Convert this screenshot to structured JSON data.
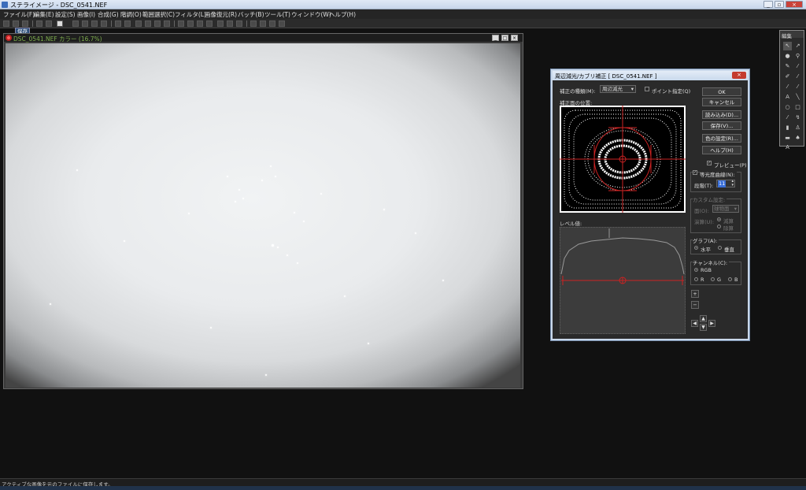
{
  "window": {
    "title": "ステライメージ - DSC_0541.NEF",
    "buttons": {
      "minimize": "_",
      "maximize": "▫",
      "close": "×"
    }
  },
  "menu": [
    "ファイル(F)",
    "編集(E)",
    "設定(S)",
    "画像(I)",
    "合成(G)",
    "階調(O)",
    "範囲選択(C)",
    "フィルタ(L)",
    "画像復元(R)",
    "バッチ(B)",
    "ツール(T)",
    "ウィンドウ(W)",
    "ヘルプ(H)"
  ],
  "toolbar": {
    "tooltip": "保存"
  },
  "image_window": {
    "title": "DSC_0541.NEF カラー (16.7%)",
    "buttons": {
      "minimize": "_",
      "maximize": "□",
      "close": "×"
    }
  },
  "dialog": {
    "title": "周辺減光/カブリ補正 [ DSC_0541.NEF ]",
    "close": "×",
    "correction_type_label": "補正の種類(M):",
    "correction_type_value": "周辺減光",
    "point_checkbox": "ポイント指定(Q)",
    "surface_label": "補正面の位置:",
    "level_label": "レベル値:",
    "buttons": [
      "OK",
      "キャンセル",
      "読み込み(D)...",
      "保存(V)...",
      "色の設定(R)...",
      "ヘルプ(H)"
    ],
    "preview_label": "プレビュー(P)",
    "contour_label": "等光度曲線(N):",
    "steps_label": "段階(T):",
    "steps_value": "11",
    "custom_group": {
      "title": "カスタム設定:",
      "object_label": "面(O):",
      "object_value": "球物面",
      "operation_label": "演算(U):",
      "radio_a": "減算",
      "radio_b": "除算"
    },
    "graph_group": {
      "title": "グラフ(A):",
      "horizontal": "水平",
      "vertical": "垂直"
    },
    "channel_group": {
      "title": "チャンネル(C):",
      "rgb": "RGB",
      "r": "R",
      "g": "G",
      "b": "B"
    },
    "zoom_in": "+",
    "zoom_out": "−",
    "arrows": {
      "up": "▲",
      "down": "▼",
      "left": "◀",
      "right": "▶"
    }
  },
  "palette": {
    "title": "編集"
  },
  "status": "アクティブな画像を元のファイルに保存します。",
  "colors": {
    "accent_red": "#cc2222",
    "title_green": "#7fb04e"
  }
}
